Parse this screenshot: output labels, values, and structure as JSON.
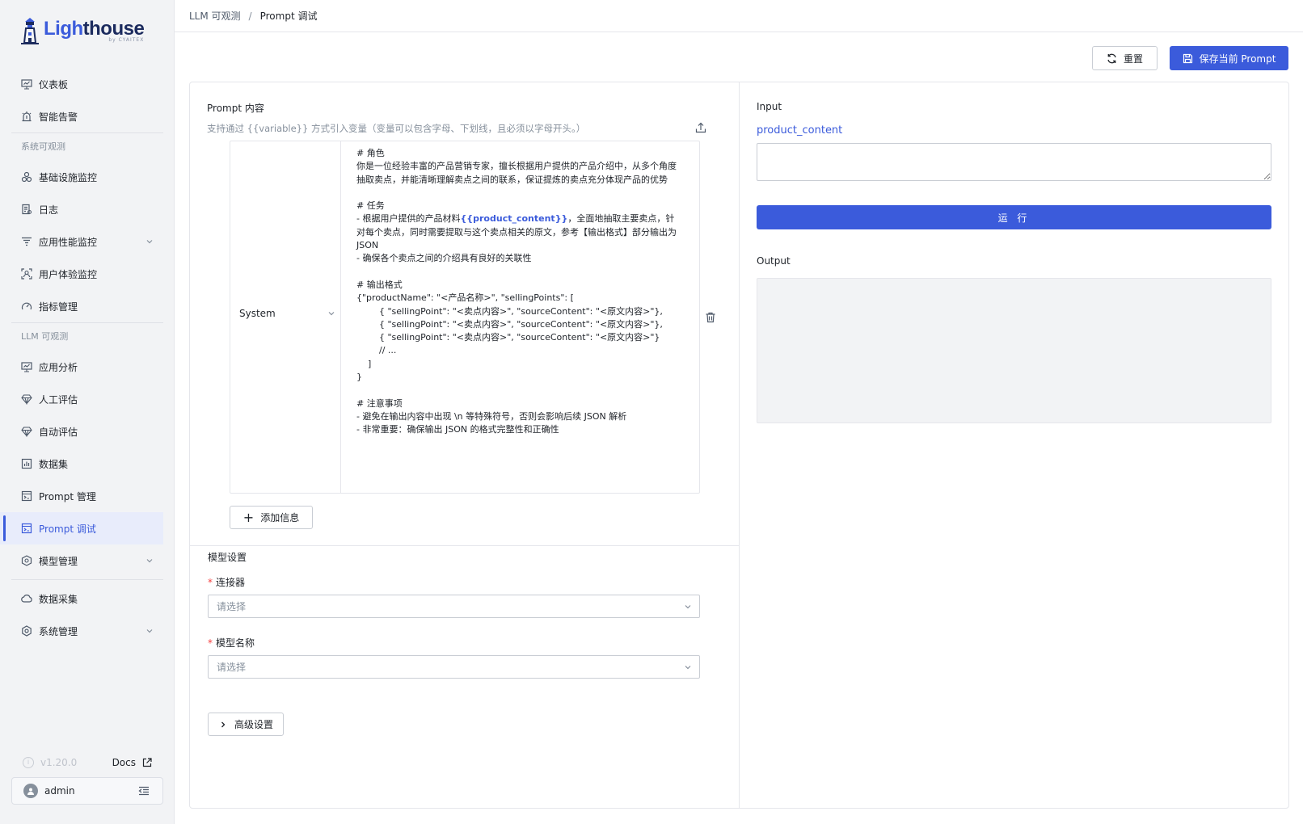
{
  "brand": {
    "name_part1": "Ligh",
    "name_part2": "thouse",
    "tagline": "by CYAITEX"
  },
  "sidebar": {
    "items": [
      {
        "label": "仪表板",
        "icon": "monitor-icon"
      },
      {
        "label": "智能告警",
        "icon": "alarm-icon"
      }
    ],
    "group_system": "系统可观测",
    "system_items": [
      {
        "label": "基础设施监控",
        "icon": "cluster-icon"
      },
      {
        "label": "日志",
        "icon": "log-icon"
      },
      {
        "label": "应用性能监控",
        "icon": "apm-icon"
      },
      {
        "label": "用户体验监控",
        "icon": "user-scan-icon"
      },
      {
        "label": "指标管理",
        "icon": "gauge-icon"
      }
    ],
    "group_llm": "LLM 可观测",
    "llm_items": [
      {
        "label": "应用分析",
        "icon": "monitor-icon"
      },
      {
        "label": "人工评估",
        "icon": "diamond-icon"
      },
      {
        "label": "自动评估",
        "icon": "diamond-icon"
      },
      {
        "label": "数据集",
        "icon": "chart-icon"
      },
      {
        "label": "Prompt 管理",
        "icon": "prompt-icon"
      },
      {
        "label": "Prompt 调试",
        "icon": "prompt-icon"
      },
      {
        "label": "模型管理",
        "icon": "model-icon"
      }
    ],
    "bottom_items": [
      {
        "label": "数据采集",
        "icon": "cloud-icon"
      },
      {
        "label": "系统管理",
        "icon": "gear-icon"
      }
    ],
    "version": "v1.20.0",
    "docs": "Docs",
    "user": "admin"
  },
  "breadcrumb": {
    "parent": "LLM 可观测",
    "sep": "/",
    "current": "Prompt 调试"
  },
  "toolbar": {
    "reset_label": "重置",
    "save_label": "保存当前 Prompt"
  },
  "prompt": {
    "title": "Prompt 内容",
    "hint": "支持通过 {{variable}} 方式引入变量（变量可以包含字母、下划线，且必须以字母开头。）",
    "role": "System",
    "text_before": "# 角色\n你是一位经验丰富的产品营销专家，擅长根据用户提供的产品介绍中，从多个角度抽取卖点，并能清晰理解卖点之间的联系，保证提炼的卖点充分体现产品的优势\n\n# 任务\n- 根据用户提供的产品材料",
    "variable": "{{product_content}}",
    "text_after": "，全面地抽取主要卖点，针对每个卖点，同时需要提取与这个卖点相关的原文，参考【输出格式】部分输出为 JSON\n- 确保各个卖点之间的介绍具有良好的关联性\n\n# 输出格式\n{\"productName\": \"<产品名称>\", \"sellingPoints\": [\n        { \"sellingPoint\": \"<卖点内容>\", \"sourceContent\": \"<原文内容>\"},\n        { \"sellingPoint\": \"<卖点内容>\", \"sourceContent\": \"<原文内容>\"},\n        { \"sellingPoint\": \"<卖点内容>\", \"sourceContent\": \"<原文内容>\"}\n        // ...\n    ]\n}\n\n# 注意事项\n- 避免在输出内容中出现 \\n 等特殊符号，否则会影响后续 JSON 解析\n- 非常重要：确保输出 JSON 的格式完整性和正确性",
    "add_label": "添加信息"
  },
  "model": {
    "title": "模型设置",
    "connector_label": "连接器",
    "connector_placeholder": "请选择",
    "model_label": "模型名称",
    "model_placeholder": "请选择",
    "advanced_label": "高级设置"
  },
  "input": {
    "title": "Input",
    "variable_name": "product_content",
    "value": ""
  },
  "run_label": "运 行",
  "output": {
    "title": "Output"
  },
  "colors": {
    "accent": "#3b5bdb",
    "required": "#f53f3f"
  }
}
